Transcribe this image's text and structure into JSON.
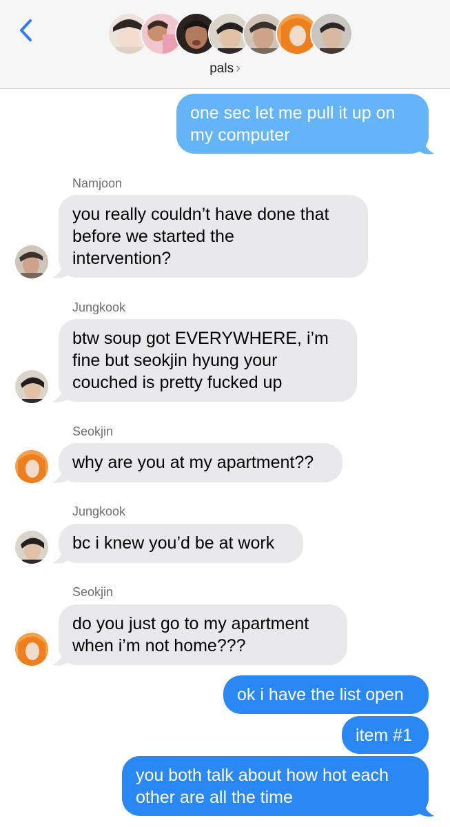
{
  "header": {
    "back_label": "‹",
    "group_name": "pals",
    "chevron": "›",
    "participants": [
      {
        "name": "participant-1",
        "colors": [
          "#e8d9cf",
          "#3a2b25"
        ]
      },
      {
        "name": "participant-2",
        "colors": [
          "#e9a8b5",
          "#c98a6a"
        ]
      },
      {
        "name": "participant-3",
        "colors": [
          "#5a4035",
          "#1e1a18"
        ]
      },
      {
        "name": "participant-4",
        "colors": [
          "#d9b89a",
          "#2a2422"
        ]
      },
      {
        "name": "participant-5",
        "colors": [
          "#b7a79a",
          "#403632"
        ]
      },
      {
        "name": "participant-6",
        "colors": [
          "#f08a2a",
          "#ead6c6"
        ]
      },
      {
        "name": "participant-7",
        "colors": [
          "#bfbcb8",
          "#3c3230"
        ]
      }
    ]
  },
  "colors": {
    "incoming_bubble": "#e9e9eb",
    "sms_bubble": "#65b4f7",
    "imessage_bubble": "#2a88f4",
    "back_arrow": "#2f7df6"
  },
  "messages": [
    {
      "id": "m1",
      "direction": "out",
      "type": "sms",
      "lines": [
        "one sec let me pull it up on",
        "my computer"
      ]
    },
    {
      "id": "m2",
      "direction": "in",
      "sender": "Namjoon",
      "lines": [
        "you really couldn’t have done that",
        "before we started the",
        "intervention?"
      ]
    },
    {
      "id": "m3",
      "direction": "in",
      "sender": "Jungkook",
      "lines": [
        "btw soup got EVERYWHERE, i’m",
        "fine but seokjin hyung your",
        "couched is pretty fucked up"
      ]
    },
    {
      "id": "m4",
      "direction": "in",
      "sender": "Seokjin",
      "lines": [
        "why are you at my apartment??"
      ]
    },
    {
      "id": "m5",
      "direction": "in",
      "sender": "Jungkook",
      "lines": [
        "bc i knew you’d be at work"
      ]
    },
    {
      "id": "m6",
      "direction": "in",
      "sender": "Seokjin",
      "lines": [
        "do you just go to my apartment",
        "when i’m not home???"
      ]
    },
    {
      "id": "m7",
      "direction": "out",
      "type": "imessage",
      "lines": [
        "ok i have the list open"
      ]
    },
    {
      "id": "m8",
      "direction": "out",
      "type": "imessage",
      "lines": [
        "item #1"
      ]
    },
    {
      "id": "m9",
      "direction": "out",
      "type": "imessage",
      "lines": [
        "you both talk about how hot each",
        "other are all the time"
      ]
    }
  ]
}
